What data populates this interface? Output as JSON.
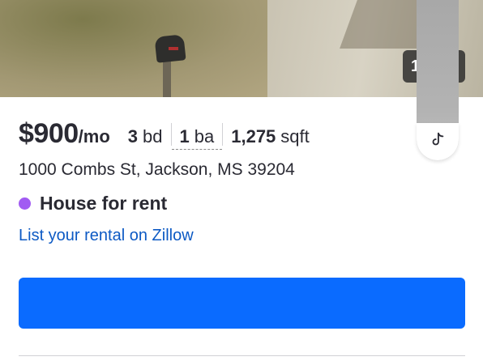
{
  "photo": {
    "counter_text": "1"
  },
  "listing": {
    "price": "$900",
    "price_unit": "/mo",
    "beds_value": "3",
    "beds_label": "bd",
    "baths_value": "1",
    "baths_label": "ba",
    "sqft_value": "1,275",
    "sqft_label": "sqft",
    "address": "1000 Combs St, Jackson, MS 39204",
    "status": "House for rent",
    "status_color": "#a15bf2",
    "list_link": "List your rental on Zillow",
    "primary_button_label": ""
  },
  "colors": {
    "primary": "#0a6bff",
    "link": "#0d5ac4",
    "text": "#2a2a33"
  },
  "icons": {
    "side_fab": "tiktok-music-note-icon"
  }
}
